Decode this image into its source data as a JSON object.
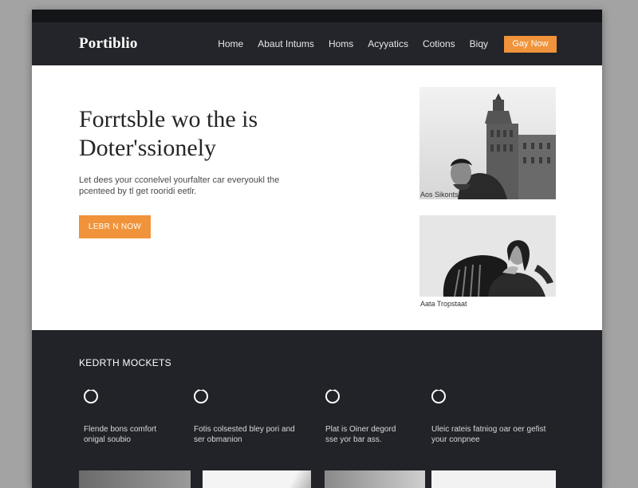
{
  "brand": {
    "logo": "Portiblio"
  },
  "nav": {
    "links": [
      "Home",
      "Abaut Intums",
      "Homs",
      "Acyyatics",
      "Cotions",
      "Biqy"
    ],
    "cta_label": "Gay Now"
  },
  "hero": {
    "title_lines": [
      "Forrtsble wo the is",
      "Doter'ssionely"
    ],
    "subtitle_lines": [
      "Let dees your cconelvel yourfalter car everyoukl the",
      "pcenteed by tl get rooridi eetlr."
    ],
    "button_label": "LEBR N NOW"
  },
  "gallery": [
    {
      "caption": "Aos Sikonts",
      "icon": "city-tower-photo"
    },
    {
      "caption": "Aata Tropstaat",
      "icon": "woman-chair-photo"
    }
  ],
  "features": {
    "title": "KEDRTH MOCKETS",
    "items": [
      {
        "icon": "power-icon",
        "lines": [
          "Flende bons comfort",
          "onigal soubio"
        ]
      },
      {
        "icon": "power-icon",
        "lines": [
          "Fotis colsested bley pori and",
          "ser obmanion"
        ]
      },
      {
        "icon": "power-icon",
        "lines": [
          "Plat is Oiner degord",
          "sse yor bar ass."
        ]
      },
      {
        "icon": "power-icon",
        "lines": [
          "Uleic rateis fatniog oar oer gefist",
          "your conpnee"
        ]
      }
    ]
  },
  "colors": {
    "accent": "#f0933b",
    "nav_bg": "#23252a",
    "dark_bg": "#212328"
  }
}
